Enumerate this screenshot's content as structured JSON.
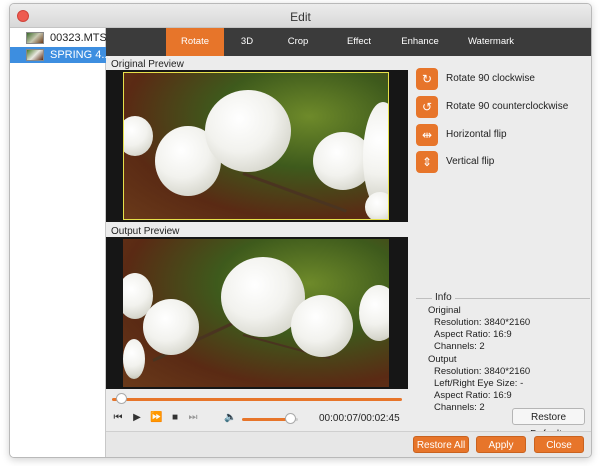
{
  "window": {
    "title": "Edit"
  },
  "files": [
    {
      "name": "00323.MTS",
      "selected": false
    },
    {
      "name": "SPRING 4...",
      "selected": true
    }
  ],
  "tabs": [
    {
      "label": "Rotate",
      "active": true
    },
    {
      "label": "3D",
      "active": false
    },
    {
      "label": "Crop",
      "active": false
    },
    {
      "label": "Effect",
      "active": false
    },
    {
      "label": "Enhance",
      "active": false
    },
    {
      "label": "Watermark",
      "active": false
    }
  ],
  "previews": {
    "original_label": "Original Preview",
    "output_label": "Output Preview"
  },
  "player": {
    "time": "00:00:07/00:02:45",
    "progress_fraction": 0.03,
    "volume_fraction": 0.85
  },
  "actions": [
    {
      "label": "Rotate 90 clockwise",
      "icon": "rotate-clockwise-icon"
    },
    {
      "label": "Rotate 90 counterclockwise",
      "icon": "rotate-counterclockwise-icon"
    },
    {
      "label": "Horizontal flip",
      "icon": "horizontal-flip-icon"
    },
    {
      "label": "Vertical flip",
      "icon": "vertical-flip-icon"
    }
  ],
  "info": {
    "title": "Info",
    "original_heading": "Original",
    "original_resolution": "Resolution: 3840*2160",
    "original_aspect": "Aspect Ratio: 16:9",
    "original_channels": "Channels: 2",
    "output_heading": "Output",
    "output_resolution": "Resolution: 3840*2160",
    "output_eye_size": "Left/Right Eye Size: -",
    "output_aspect": "Aspect Ratio: 16:9",
    "output_channels": "Channels: 2"
  },
  "buttons": {
    "restore_defaults": "Restore Defaults",
    "restore_all": "Restore All",
    "apply": "Apply",
    "close": "Close"
  },
  "colors": {
    "accent": "#e7752a",
    "tabbar": "#3b3b3b",
    "selection": "#3d8ee0"
  }
}
